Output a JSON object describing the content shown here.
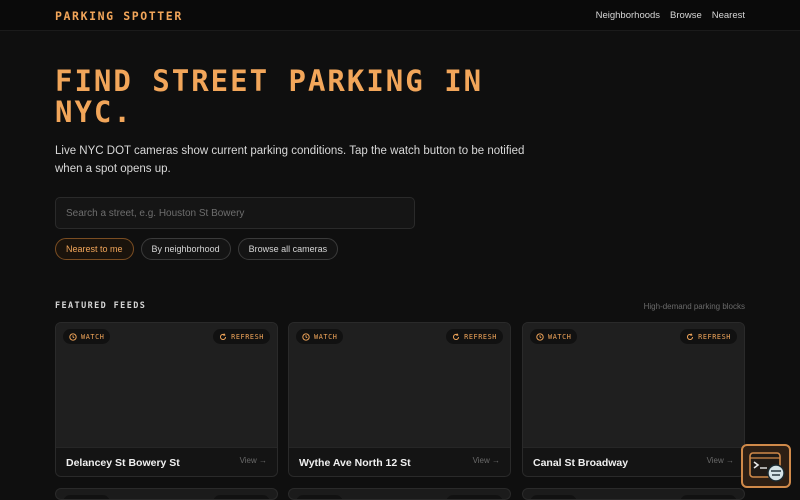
{
  "app": {
    "brand": "PARKING SPOTTER"
  },
  "nav": [
    {
      "label": "Neighborhoods"
    },
    {
      "label": "Browse"
    },
    {
      "label": "Nearest"
    }
  ],
  "hero": {
    "title": "FIND STREET PARKING IN NYC.",
    "subtitle": "Live NYC DOT cameras show current parking conditions. Tap the watch button to be notified when a spot opens up."
  },
  "search": {
    "placeholder": "Search a street, e.g. Houston St Bowery",
    "value": ""
  },
  "filters": [
    {
      "label": "Nearest to me",
      "active": true
    },
    {
      "label": "By neighborhood",
      "active": false
    },
    {
      "label": "Browse all cameras",
      "active": false
    }
  ],
  "featured": {
    "label": "FEATURED FEEDS",
    "note": "High-demand parking blocks",
    "watch_label": "WATCH",
    "refresh_label": "REFRESH",
    "view_label": "View →",
    "cards": [
      {
        "name": "Delancey St Bowery St"
      },
      {
        "name": "Wythe Ave North 12 St"
      },
      {
        "name": "Canal St Broadway"
      }
    ]
  },
  "colors": {
    "accent": "#f2a65a",
    "background": "#0f0f0f",
    "card": "#1b1b1b"
  },
  "icons": {
    "watch": "clock-icon",
    "refresh": "refresh-icon",
    "fab": "terminal-chat-icon"
  }
}
